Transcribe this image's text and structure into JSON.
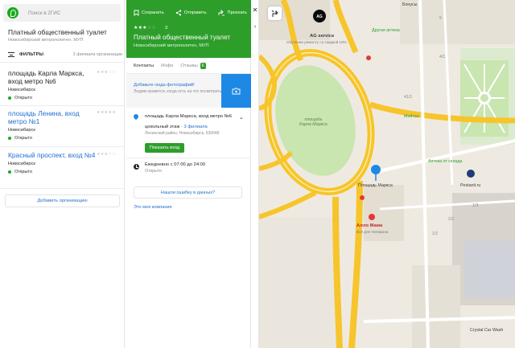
{
  "search": {
    "placeholder": "Поиск в 2ГИС"
  },
  "list": {
    "title": "Платный общественный туалет",
    "subtitle": "Новосибирский метрополитен, МУП",
    "filters_label": "ФИЛЬТРЫ",
    "count_label": "3 филиала организации",
    "items": [
      {
        "name": "площадь Карла Маркса, вход метро №6",
        "city": "Новосибирск",
        "status": "Открыто",
        "stars": "★★★☆☆"
      },
      {
        "name": "площадь Ленина, вход метро №1",
        "city": "Новосибирск",
        "status": "Открыто",
        "stars": "★★★★★"
      },
      {
        "name": "Красный проспект, вход №4",
        "city": "Новосибирск",
        "status": "Открыто",
        "stars": "★★★☆☆"
      }
    ],
    "add_org": "Добавить организацию"
  },
  "card": {
    "actions": [
      "Сохранить",
      "Отправить",
      "Проехать"
    ],
    "rating_value": "3",
    "rating_stars_on": "★★★",
    "rating_stars_off": "☆☆",
    "title": "Платный общественный туалет",
    "subtitle": "Новосибирский метрополитен, МУП",
    "tabs": [
      {
        "label": "Контакты"
      },
      {
        "label": "Инфо"
      },
      {
        "label": "Отзывы",
        "count": "6"
      }
    ],
    "photo_link": "Добавьте сюда фотографий!",
    "photo_desc": "Людям нравится, когда есть на что посмотреть",
    "address": "площадь Карла Маркса, вход метро №6",
    "floor": "цокольный этаж",
    "branches_link": "3 филиала",
    "district": "Ленинский район, Новосибирск, 630048",
    "show_entrance": "Показать вход",
    "hours": "Ежедневно с 07:00 до 24:00",
    "hours_status": "Открыто",
    "report_error": "Нашли ошибку в данных?",
    "about_company": "Это моя компания"
  },
  "map": {
    "labels": {
      "ag": "AG service",
      "ag_sub": "Обучение ремонту со скидкой 10%",
      "bonus": "Бонусы",
      "pharmacy": "Другая аптека",
      "square": "площадь\nКарла Маркса",
      "meitan": "Мейтан",
      "apteka": "Аптека от склада",
      "pestanit": "Pestanit.ru",
      "metro": "Площадь Маркса",
      "allo": "Алло Мама",
      "allo_sub": "Всё для телефона",
      "car": "Crystal Car Wash",
      "n1": "4/1",
      "n2": "5",
      "n3": "1/1",
      "n4": "2/1",
      "n5": "41/1",
      "n6": "1/3"
    }
  },
  "colors": {
    "brand": "#2e9e2b",
    "link": "#1e6fd1",
    "road": "#f7c52b",
    "park": "#c9e5b0"
  }
}
